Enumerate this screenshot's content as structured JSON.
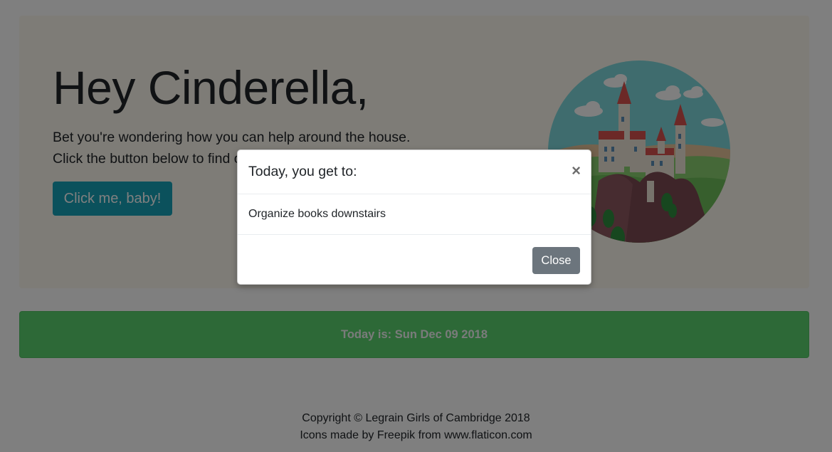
{
  "hero": {
    "title": "Hey Cinderella,",
    "line1": "Bet you're wondering how you can help around the house.",
    "line2": "Click the button below to find out!",
    "button_label": "Click me, baby!",
    "illustration_icon": "castle-icon"
  },
  "date_banner": {
    "text": "Today is: Sun Dec 09 2018"
  },
  "footer": {
    "copyright": "Copyright © Legrain Girls of Cambridge 2018",
    "credits": "Icons made by Freepik from www.flaticon.com"
  },
  "modal": {
    "title": "Today, you get to:",
    "close_icon": "×",
    "body": "Organize books downstairs",
    "close_button_label": "Close"
  },
  "colors": {
    "info_button": "#17a2b8",
    "success_banner": "#5bd36e",
    "secondary_button": "#6c757d",
    "jumbotron_bg": "#fdf8ee"
  }
}
